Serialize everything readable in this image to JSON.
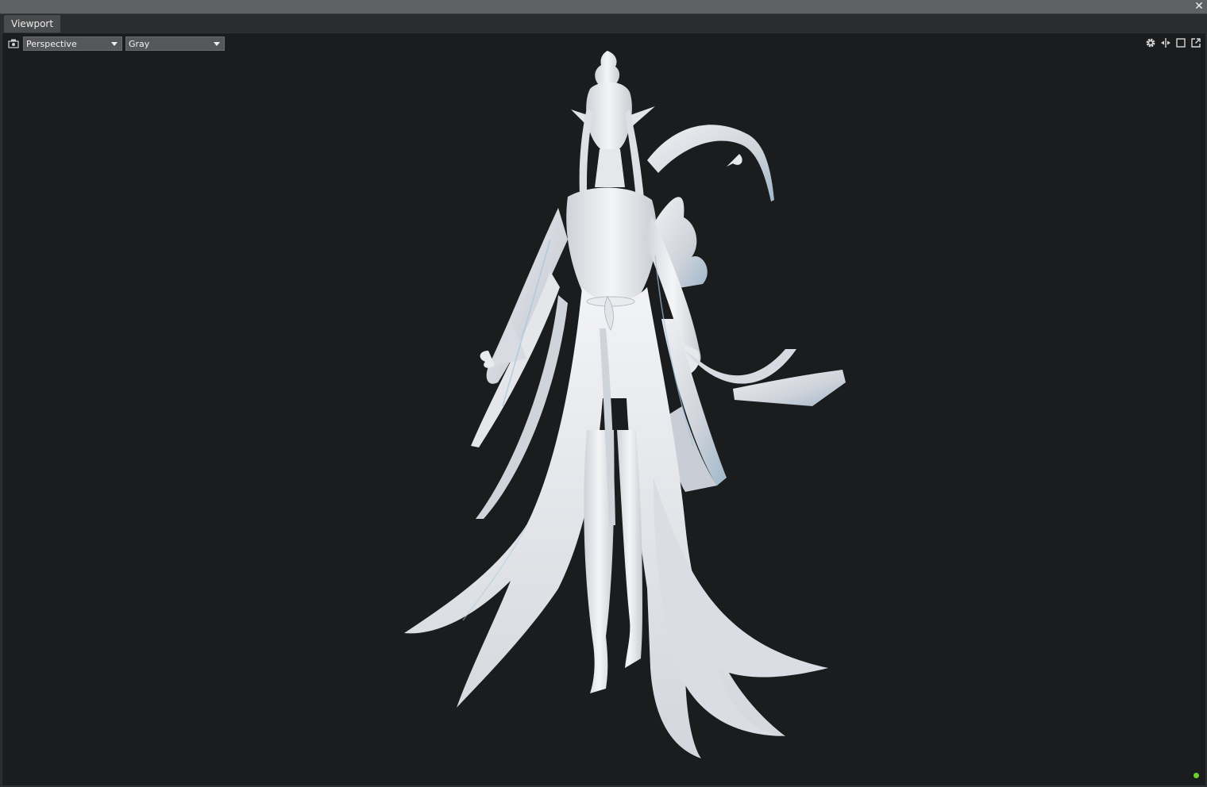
{
  "window": {
    "close_glyph": "✕"
  },
  "tabs": [
    {
      "label": "Viewport"
    }
  ],
  "viewport": {
    "view_mode": "Perspective",
    "shading_mode": "Gray",
    "tool_icons": [
      "settings-icon",
      "transform-icon",
      "maximize-icon",
      "popout-icon"
    ],
    "status_color": "#6fcf2d",
    "background_color": "#1b1c1e",
    "model_color": "#e9eaee"
  }
}
